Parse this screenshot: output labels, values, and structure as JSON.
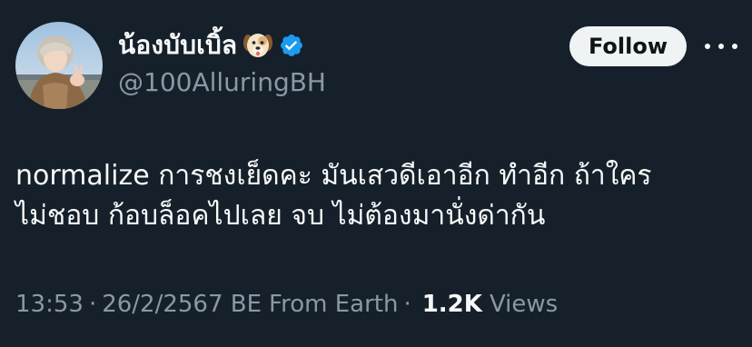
{
  "author": {
    "display_name": "น้องบับเบิ้ล",
    "emoji_icon": "dog-face-emoji",
    "verified_icon": "verified-badge-icon",
    "handle": "@100AlluringBH",
    "avatar": "profile-avatar"
  },
  "follow_label": "Follow",
  "more_icon": "more-options-icon",
  "tweet": {
    "lines": [
      "normalize การชงเย็ดคะ มันเสวดีเอาอีก ทำอีก ถ้าใคร",
      "ไม่ชอบ ก้อบล็อคไปเลย จบ ไม่ต้องมานั่งด่ากัน"
    ]
  },
  "meta": {
    "time": "13:53",
    "separator": "·",
    "date": "26/2/2567 BE",
    "source": "From Earth",
    "views_count": "1.2K",
    "views_label": "Views"
  },
  "colors": {
    "background": "#15202b",
    "text": "#f7f9f9",
    "secondary": "#8b98a5",
    "verified": "#1d9bf0",
    "button_bg": "#eff3f4"
  }
}
